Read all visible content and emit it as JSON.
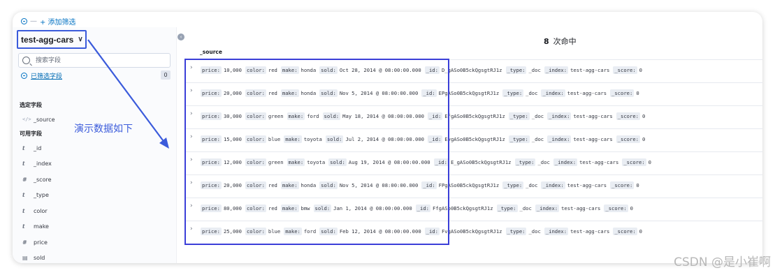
{
  "filter_bar": {
    "separator": "—",
    "add_filter": "+ 添加筛选"
  },
  "index_pattern": {
    "name": "test-agg-cars",
    "chevron": "∨"
  },
  "sidebar": {
    "search_placeholder": "搜索字段",
    "filtered_fields": {
      "label": "已筛选字段",
      "count": "0"
    },
    "selected_title": "选定字段",
    "selected_fields": [
      {
        "icon": "</>",
        "name": "_source"
      }
    ],
    "available_title": "可用字段",
    "available_fields": [
      {
        "icon": "t",
        "name": "_id"
      },
      {
        "icon": "t",
        "name": "_index"
      },
      {
        "icon": "#",
        "name": "_score"
      },
      {
        "icon": "t",
        "name": "_type"
      },
      {
        "icon": "t",
        "name": "color"
      },
      {
        "icon": "t",
        "name": "make"
      },
      {
        "icon": "#",
        "name": "price"
      },
      {
        "icon": "▤",
        "name": "sold"
      }
    ]
  },
  "annotation": "演示数据如下",
  "collapse_icon": "‹",
  "hits": {
    "count": "8",
    "label": "次命中"
  },
  "table": {
    "column": "_source",
    "rows": [
      {
        "price": "10,000",
        "color": "red",
        "make": "honda",
        "sold": "Oct 28, 2014 @ 08:00:00.000",
        "_id": "D_gASo0B5ckQgsgtRJ1z",
        "_type": "_doc",
        "_index": "test-agg-cars",
        "_score": "0"
      },
      {
        "price": "20,000",
        "color": "red",
        "make": "honda",
        "sold": "Nov 5, 2014 @ 08:00:00.000",
        "_id": "EPgASo0B5ckQgsgtRJ1z",
        "_type": "_doc",
        "_index": "test-agg-cars",
        "_score": "0"
      },
      {
        "price": "30,000",
        "color": "green",
        "make": "ford",
        "sold": "May 18, 2014 @ 08:00:00.000",
        "_id": "EfgASo0B5ckQgsgtRJ1z",
        "_type": "_doc",
        "_index": "test-agg-cars",
        "_score": "0"
      },
      {
        "price": "15,000",
        "color": "blue",
        "make": "toyota",
        "sold": "Jul 2, 2014 @ 08:00:00.000",
        "_id": "EvgASo0B5ckQgsgtRJ1z",
        "_type": "_doc",
        "_index": "test-agg-cars",
        "_score": "0"
      },
      {
        "price": "12,000",
        "color": "green",
        "make": "toyota",
        "sold": "Aug 19, 2014 @ 08:00:00.000",
        "_id": "E_gASo0B5ckQgsgtRJ1z",
        "_type": "_doc",
        "_index": "test-agg-cars",
        "_score": "0"
      },
      {
        "price": "20,000",
        "color": "red",
        "make": "honda",
        "sold": "Nov 5, 2014 @ 08:00:00.000",
        "_id": "FPgASo0B5ckQgsgtRJ1z",
        "_type": "_doc",
        "_index": "test-agg-cars",
        "_score": "0"
      },
      {
        "price": "80,000",
        "color": "red",
        "make": "bmw",
        "sold": "Jan 1, 2014 @ 08:00:00.000",
        "_id": "FfgASo0B5ckQgsgtRJ1z",
        "_type": "_doc",
        "_index": "test-agg-cars",
        "_score": "0"
      },
      {
        "price": "25,000",
        "color": "blue",
        "make": "ford",
        "sold": "Feb 12, 2014 @ 08:00:00.000",
        "_id": "FvgASo0B5ckQgsgtRJ1z",
        "_type": "_doc",
        "_index": "test-agg-cars",
        "_score": "0"
      }
    ]
  },
  "watermark": "CSDN @是小崔啊",
  "colors": {
    "link": "#0071c2",
    "annotation": "#3b5bdb",
    "highlight": "#3b3fd8"
  }
}
